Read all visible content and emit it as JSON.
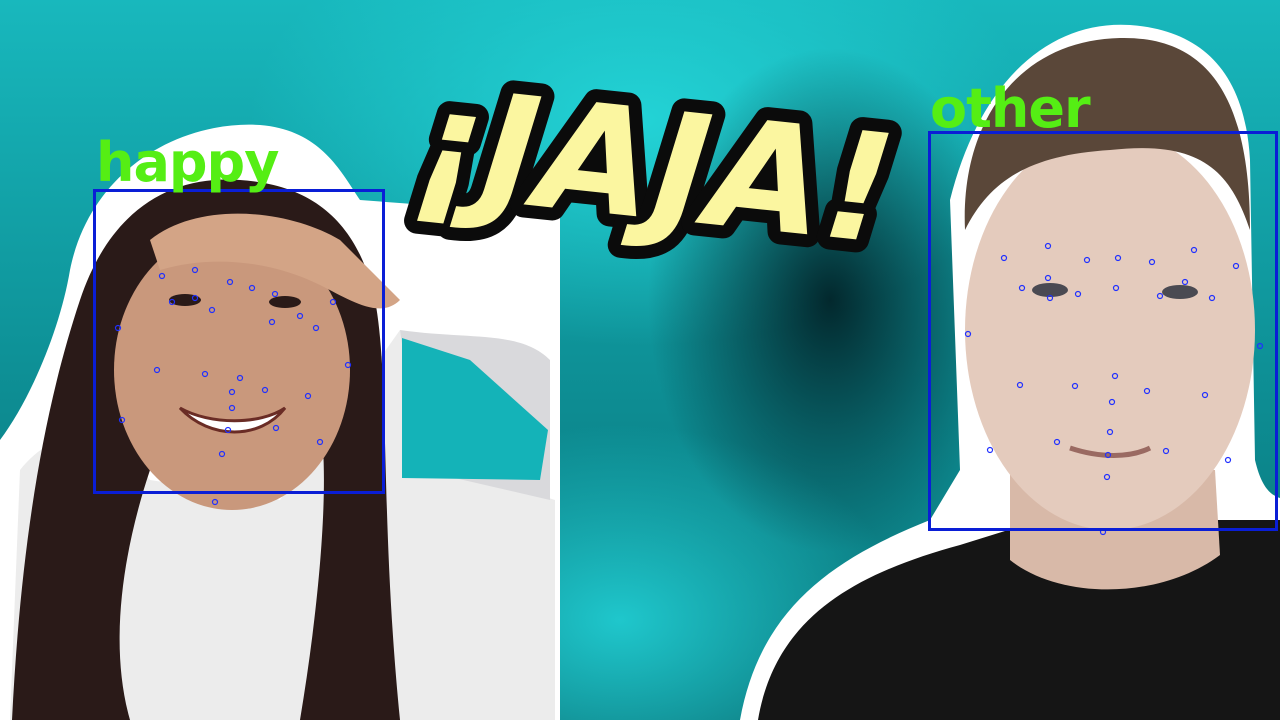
{
  "caption": {
    "text": "¡JAJA!",
    "fill_color": "#fbf6a0",
    "outline_color": "#0b0b0b"
  },
  "detections": [
    {
      "label": "happy",
      "box_color": "#0a1ed6",
      "label_color": "#55ee14"
    },
    {
      "label": "other",
      "box_color": "#0a1ed6",
      "label_color": "#55ee14"
    }
  ],
  "scene": {
    "background_color": "#18b8bd",
    "subjects": [
      "person-left-smiling",
      "person-right-talking"
    ]
  }
}
